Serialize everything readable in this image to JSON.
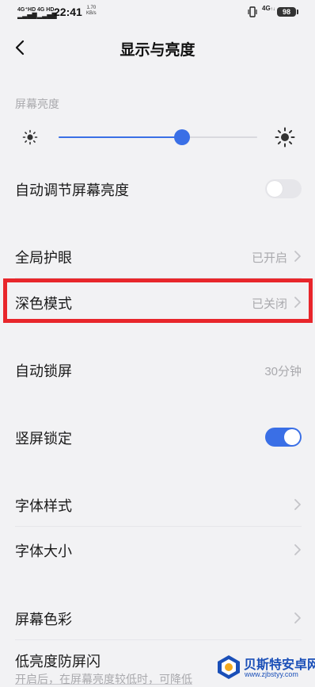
{
  "status_bar": {
    "signal_1": "4G⁺HD",
    "signal_2": "4G HD",
    "time": "22:41",
    "speed_value": "1.70",
    "speed_unit": "KB/s",
    "network_right": "4G",
    "battery": "98"
  },
  "header": {
    "title": "显示与亮度",
    "back_icon": "chevron-left-icon"
  },
  "brightness": {
    "section_label": "屏幕亮度",
    "level_percent": 62,
    "low_icon": "sun-small-icon",
    "high_icon": "sun-large-icon",
    "accent_color": "#3a6fe6"
  },
  "rows": {
    "auto_brightness": {
      "label": "自动调节屏幕亮度",
      "toggle": "off"
    },
    "eye_protection": {
      "label": "全局护眼",
      "value": "已开启"
    },
    "dark_mode": {
      "label": "深色模式",
      "value": "已关闭"
    },
    "auto_lock": {
      "label": "自动锁屏",
      "value": "30分钟"
    },
    "portrait_lock": {
      "label": "竖屏锁定",
      "toggle": "on"
    },
    "font_style": {
      "label": "字体样式"
    },
    "font_size": {
      "label": "字体大小"
    },
    "screen_color": {
      "label": "屏幕色彩"
    },
    "low_brightness_flicker": {
      "label": "低亮度防屏闪",
      "description": "开启后，在屏幕亮度较低时，可降低"
    }
  },
  "highlight_color": "#e8262b",
  "watermark": {
    "name": "贝斯特安卓网",
    "url": "www.zjbstyy.com"
  }
}
